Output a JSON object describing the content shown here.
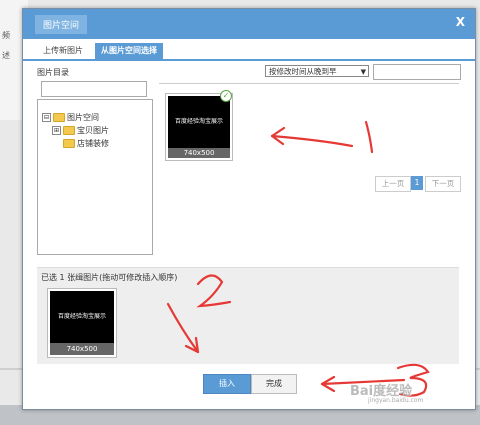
{
  "background": {
    "left_labels": [
      "频",
      "述"
    ]
  },
  "dialog": {
    "title": "图片空间",
    "close_label": "X",
    "tabs": [
      {
        "label": "上传新图片"
      },
      {
        "label": "从图片空间选择"
      }
    ],
    "directory_label": "图片目录",
    "tree": {
      "root": {
        "label": "图片空间",
        "expander": "⊟"
      },
      "children": [
        {
          "label": "宝贝图片",
          "expander": "⊞"
        },
        {
          "label": "店铺装修"
        }
      ]
    },
    "sort_select": {
      "value": "按修改时间从晚到早",
      "arrow": "▼"
    },
    "gallery": [
      {
        "image_text": "百度经验淘宝展示",
        "caption": "740x500",
        "checked": true
      }
    ],
    "pager": {
      "prev": "上一页",
      "current": "1",
      "next": "下一页"
    },
    "selected": {
      "label": "已选 1 张缉图片(拖动可修改插入顺序)",
      "items": [
        {
          "image_text": "百度经验淘宝展示",
          "caption": "740x500"
        }
      ]
    },
    "buttons": {
      "insert": "插入",
      "done": "完成"
    }
  },
  "annotations": {
    "numbers": [
      "1",
      "2",
      "3"
    ],
    "color": "#e53935"
  },
  "watermark": {
    "text": "Bai度经验",
    "sub": "jingyan.baidu.com"
  },
  "colors": {
    "accent": "#5b9bd5",
    "annotation": "#e53935"
  }
}
